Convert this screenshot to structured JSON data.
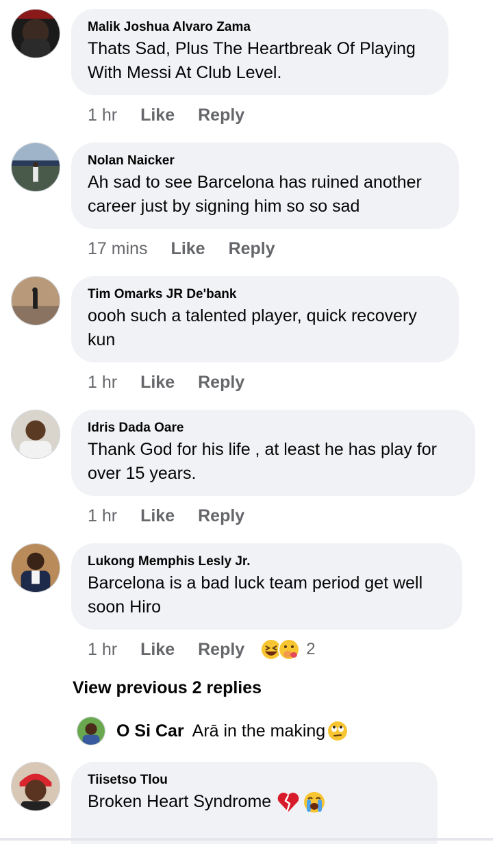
{
  "comments": [
    {
      "author": "Malik Joshua Alvaro Zama",
      "lines": [
        "Thats Sad, Plus The Heartbreak Of Playing",
        "With Messi At Club Level."
      ],
      "time": "1 hr",
      "like": "Like",
      "reply": "Reply"
    },
    {
      "author": "Nolan Naicker",
      "lines": [
        "Ah sad to see Barcelona has ruined another",
        "career just by signing him so so sad"
      ],
      "time": "17 mins",
      "like": "Like",
      "reply": "Reply"
    },
    {
      "author": "Tim Omarks JR De'bank",
      "lines": [
        "oooh such a talented  player, quick recovery",
        "kun"
      ],
      "time": "1 hr",
      "like": "Like",
      "reply": "Reply"
    },
    {
      "author": "Idris Dada Oare",
      "lines": [
        "Thank God for his life , at least he has play for",
        "over 15 years."
      ],
      "time": "1 hr",
      "like": "Like",
      "reply": "Reply"
    },
    {
      "author": "Lukong Memphis Lesly Jr.",
      "lines": [
        "Barcelona is a bad luck team period get well",
        "soon Hiro"
      ],
      "time": "1 hr",
      "like": "Like",
      "reply": "Reply",
      "reactions": {
        "icons": [
          "laughing-emoji",
          "hugging-emoji"
        ],
        "count": "2"
      }
    }
  ],
  "view_previous": "View previous 2 replies",
  "nested_reply": {
    "author": "O Si Car",
    "text": "Arā in the making",
    "emoji": "face-with-rolling-eyes"
  },
  "last_comment": {
    "author": "Tiisetso Tlou",
    "text": "Broken Heart Syndrome",
    "emojis": [
      "broken-heart",
      "loudly-crying-face"
    ]
  },
  "colors": {
    "bubble": "#f0f2f5",
    "meta": "#65676b",
    "text": "#050505"
  }
}
